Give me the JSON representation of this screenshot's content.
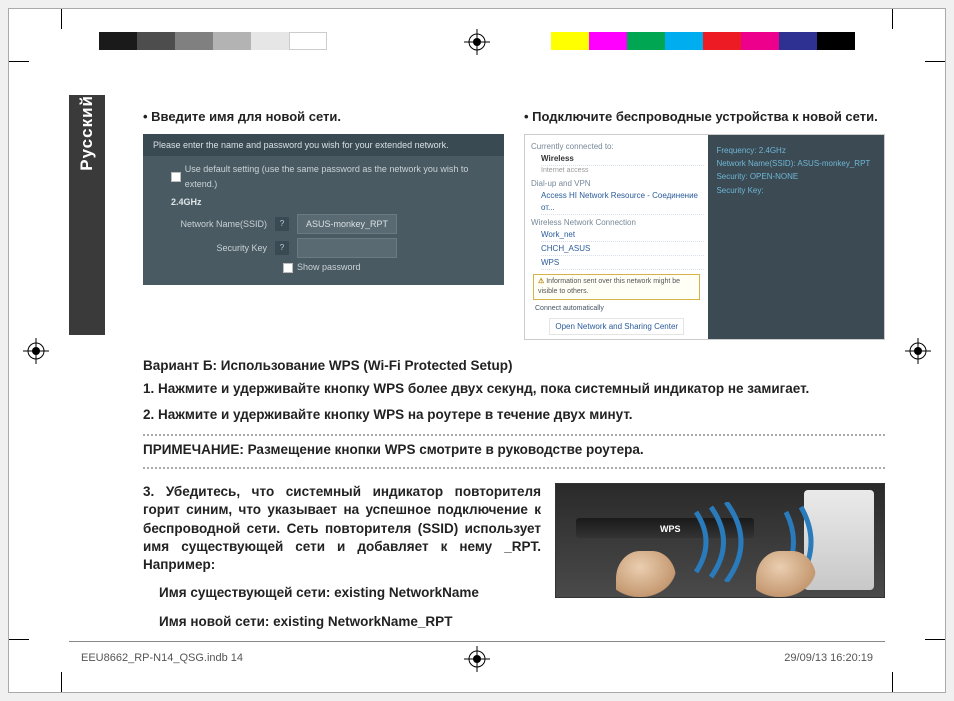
{
  "sidetab": "Русский",
  "section_a": {
    "title": "Введите имя для новой сети.",
    "dialog": {
      "header": "Please enter the name and password you wish for your extended network.",
      "use_default": "Use default setting (use the same password as the network you wish to extend.)",
      "freq_tag": "2.4GHz",
      "ssid_label": "Network Name(SSID)",
      "ssid_value": "ASUS-monkey_RPT",
      "seckey_label": "Security Key",
      "showpw": "Show password"
    }
  },
  "section_b": {
    "title": "Подключите беспроводные устройства к новой сети.",
    "left": {
      "currently": "Currently connected to:",
      "wireless": "Wireless",
      "internet": "Internet access",
      "dialup": "Dial-up and VPN",
      "access_hi": "Access HI Network Resource - Соединение от...",
      "wnc": "Wireless Network Connection",
      "worknet": "Work_net",
      "chch": "CHCH_ASUS",
      "wps": "WPS",
      "warn": "Information sent over this network might be visible to others.",
      "connect_auto": "Connect automatically",
      "open_center": "Open Network and Sharing Center"
    },
    "right": {
      "freq": "Frequency: 2.4GHz",
      "ssid": "Network Name(SSID): ASUS-monkey_RPT",
      "sec": "Security: OPEN-NONE",
      "key": "Security Key:"
    }
  },
  "option_b_title": "Вариант Б: Использование WPS (Wi-Fi Protected Setup)",
  "step1": "1. Нажмите и удерживайте кнопку WPS более двух секунд, пока системный индикатор не замигает.",
  "step2": "2. Нажмите и удерживайте кнопку WPS на роутере в течение двух минут.",
  "note": "ПРИМЕЧАНИЕ: Размещение кнопки WPS смотрите в руководстве роутера.",
  "step3": {
    "main": "3. Убедитесь, что системный индикатор повторителя горит синим, что указывает на успешное подключение к беспроводной сети. Сеть повторителя (SSID) использует имя существующей сети и добавляет к нему _RPT. Например:",
    "line1": "Имя существующей сети: existing NetworkName",
    "line2": "Имя новой сети: existing NetworkName_RPT"
  },
  "wps_label": "WPS",
  "footer": {
    "file": "EEU8662_RP-N14_QSG.indb   14",
    "date": "29/09/13   16:20:19"
  },
  "colors": {
    "gray_bar": [
      "#1a1a1a",
      "#4d4d4d",
      "#808080",
      "#b3b3b3",
      "#e6e6e6",
      "#ffffff"
    ],
    "color_bar": [
      "#ffff00",
      "#ff00ff",
      "#00a651",
      "#00aeef",
      "#ed1c24",
      "#ec008c",
      "#2e3192",
      "#000000"
    ]
  }
}
